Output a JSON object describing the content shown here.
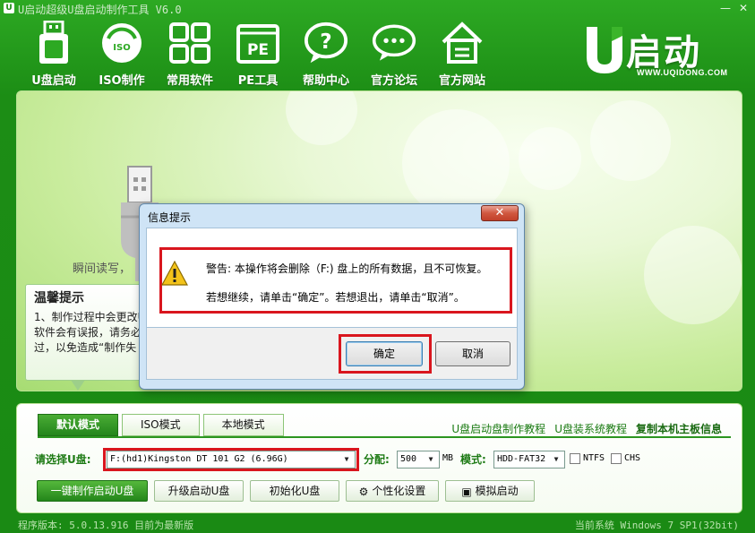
{
  "window": {
    "title": "U启动超级U盘启动制作工具 V6.0",
    "minimize_icon": "minimize-icon",
    "close_icon": "close-icon"
  },
  "toolbar": {
    "items": [
      {
        "label": "U盘启动",
        "icon": "usb-drive-icon"
      },
      {
        "label": "ISO制作",
        "icon": "iso-disc-icon"
      },
      {
        "label": "常用软件",
        "icon": "grid-apps-icon"
      },
      {
        "label": "PE工具",
        "icon": "pe-box-icon"
      },
      {
        "label": "帮助中心",
        "icon": "help-bubble-icon"
      },
      {
        "label": "官方论坛",
        "icon": "forum-chat-icon"
      },
      {
        "label": "官方网站",
        "icon": "home-icon"
      }
    ]
  },
  "brand": {
    "logo_text": "启动",
    "url": "WWW.UQIDONG.COM"
  },
  "main": {
    "flash_text": "瞬间读写，",
    "tip": {
      "title": "温馨提示",
      "body": "1、制作过程中会更改U\n软件会有误报，请务必\n过，以免造成“制作失"
    }
  },
  "dialog": {
    "title": "信息提示",
    "close_label": "✕",
    "message_line1": "警告: 本操作将会删除（F:) 盘上的所有数据，且不可恢复。",
    "message_line2": "若想继续，请单击“确定”。若想退出，请单击“取消”。",
    "ok_label": "确定",
    "cancel_label": "取消"
  },
  "bottom": {
    "tabs": [
      {
        "label": "默认模式",
        "active": true
      },
      {
        "label": "ISO模式",
        "active": false
      },
      {
        "label": "本地模式",
        "active": false
      }
    ],
    "links": [
      {
        "label": "U盘启动盘制作教程"
      },
      {
        "label": "U盘装系统教程"
      },
      {
        "label": "复制本机主板信息"
      }
    ],
    "select_u_label": "请选择U盘:",
    "select_u_value": "F:(hd1)Kingston DT 101 G2 (6.96G)",
    "partition_label": "分配:",
    "partition_value": "500",
    "partition_unit": "MB",
    "mode_label": "模式:",
    "mode_value": "HDD-FAT32",
    "ntfs_label": "NTFS",
    "chs_label": "CHS",
    "buttons": {
      "make": "一键制作启动U盘",
      "upgrade": "升级启动U盘",
      "init": "初始化U盘",
      "personalize": "个性化设置",
      "simulate": "模拟启动"
    }
  },
  "status": {
    "left": "程序版本: 5.0.13.916 目前为最新版",
    "right": "当前系统 Windows 7 SP1(32bit)"
  },
  "colors": {
    "brand_green": "#1c8d15",
    "highlight_red": "#d9161e",
    "dialog_blue": "#cfe4f6"
  }
}
